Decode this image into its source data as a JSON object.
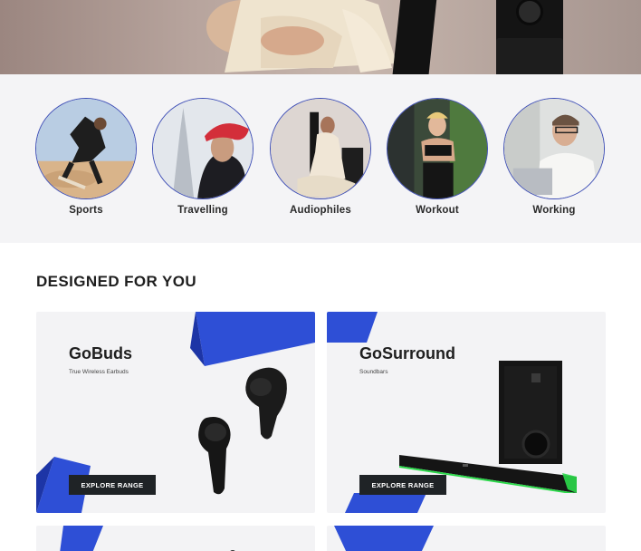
{
  "activities": [
    {
      "label": "Sports"
    },
    {
      "label": "Travelling"
    },
    {
      "label": "Audiophiles"
    },
    {
      "label": "Workout"
    },
    {
      "label": "Working"
    }
  ],
  "section": {
    "title": "DESIGNED FOR YOU"
  },
  "products": [
    {
      "name": "GoBuds",
      "subtitle": "True Wireless Earbuds",
      "cta": "EXPLORE RANGE"
    },
    {
      "name": "GoSurround",
      "subtitle": "Soundbars",
      "cta": "EXPLORE RANGE"
    }
  ],
  "colors": {
    "accent_blue": "#2e4fd6",
    "button_dark": "#1f2326",
    "soundbar_glow": "#2bd94a"
  }
}
